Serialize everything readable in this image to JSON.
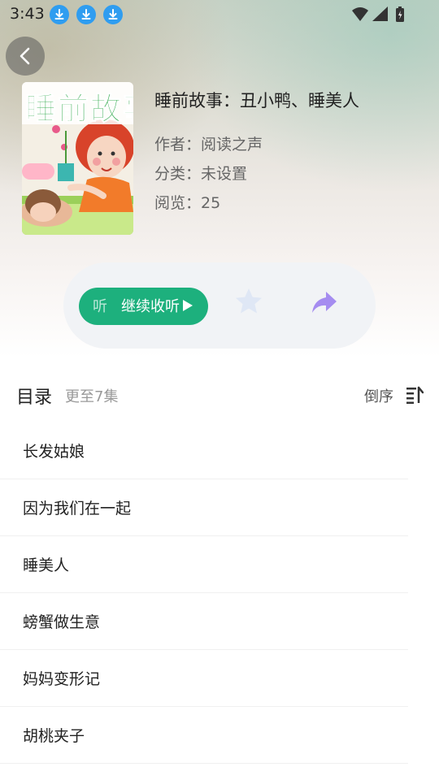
{
  "status_bar": {
    "time": "3:43"
  },
  "book": {
    "cover_text": "睡前故事",
    "title": "睡前故事：丑小鸭、睡美人",
    "author": "作者：阅读之声",
    "category": "分类：未设置",
    "views": "阅览：25"
  },
  "actions": {
    "play_label_prefix": "听",
    "play_label": "继续收听",
    "favorite": "star-icon",
    "share": "share-icon"
  },
  "toc": {
    "title": "目录",
    "count": "更至7集",
    "sort_label": "倒序",
    "items": [
      {
        "title": "长发姑娘"
      },
      {
        "title": "因为我们在一起"
      },
      {
        "title": "睡美人"
      },
      {
        "title": "螃蟹做生意"
      },
      {
        "title": "妈妈变形记"
      },
      {
        "title": "胡桃夹子"
      }
    ]
  },
  "colors": {
    "accent_green": "#1db07d",
    "download_blue": "#2f9df0",
    "share_purple": "#a58cf0",
    "star_light": "#dfe7f5"
  }
}
